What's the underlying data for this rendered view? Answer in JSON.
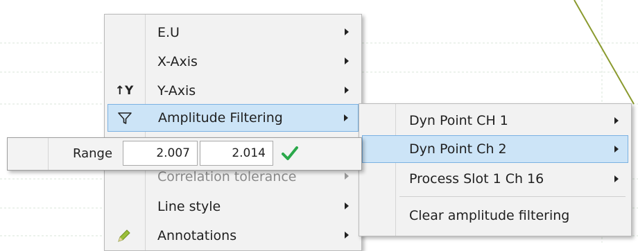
{
  "context_menu": {
    "items": [
      {
        "label": "E.U",
        "icon": "",
        "has_submenu": true
      },
      {
        "label": "X-Axis",
        "icon": "",
        "has_submenu": true
      },
      {
        "label": "Y-Axis",
        "icon": "y-axis-icon",
        "icon_text": "↑Y",
        "has_submenu": true
      },
      {
        "label": "Amplitude Filtering",
        "icon": "funnel-filter-icon",
        "has_submenu": true,
        "highlighted": true
      },
      {
        "label": "Correlation tolerance",
        "icon": "",
        "has_submenu": true,
        "partially_hidden": true
      },
      {
        "label": "Line style",
        "icon": "",
        "has_submenu": true
      },
      {
        "label": "Annotations",
        "icon": "pencil-icon",
        "has_submenu": true
      }
    ]
  },
  "amplitude_submenu": {
    "items": [
      {
        "label": "Dyn Point CH 1",
        "has_submenu": true
      },
      {
        "label": "Dyn Point Ch 2",
        "has_submenu": true,
        "highlighted": true
      },
      {
        "label": "Process Slot 1 Ch 16",
        "has_submenu": true
      },
      {
        "label": "Clear amplitude filtering",
        "has_submenu": false
      }
    ]
  },
  "range_panel": {
    "label": "Range",
    "min_value": "2.007",
    "max_value": "2.014",
    "confirm_icon": "green-check-icon"
  },
  "colors": {
    "highlight": "#cce4f7",
    "highlight_border": "#7ab1e2",
    "trace": "#8a9a2e",
    "check": "#2aa84a"
  }
}
